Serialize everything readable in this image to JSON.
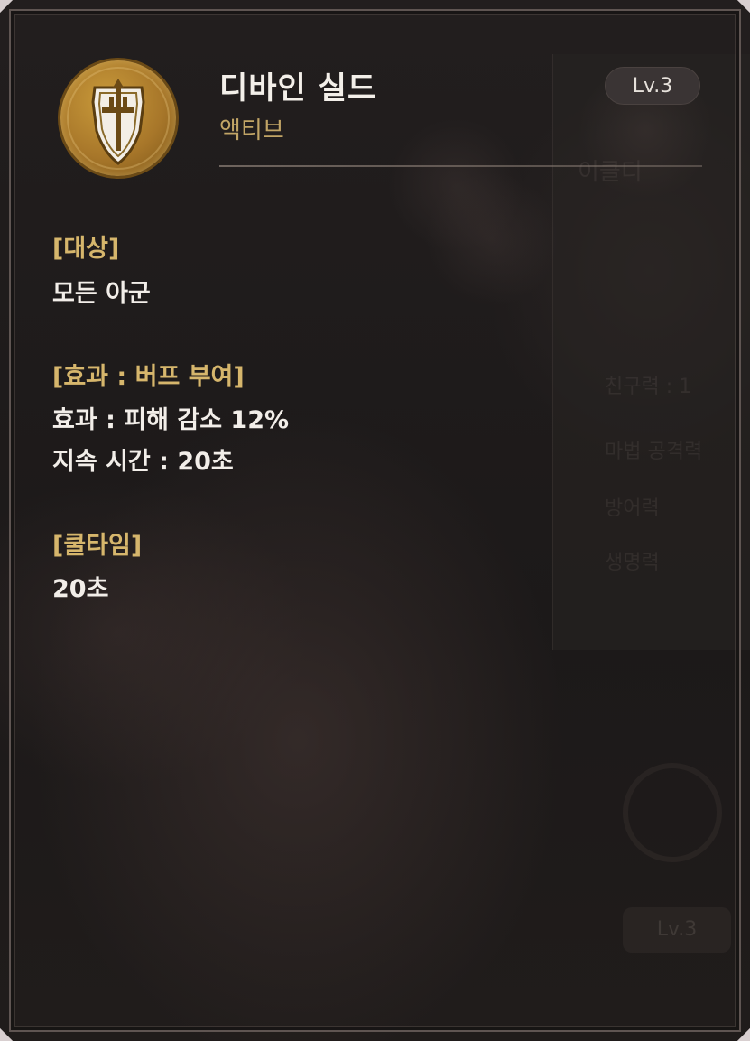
{
  "skill": {
    "name": "디바인 실드",
    "type": "액티브",
    "level": "Lv.3",
    "icon": "shield-sword-icon"
  },
  "sections": {
    "target": {
      "heading": "[대상]",
      "lines": [
        "모든 아군"
      ]
    },
    "effect": {
      "heading": "[효과 : 버프 부여]",
      "lines": [
        "효과 : 피해 감소 12%",
        "지속 시간 : 20초"
      ]
    },
    "cooldown": {
      "heading": "[쿨타임]",
      "lines": [
        "20초"
      ]
    }
  },
  "colors": {
    "panel_bg": "#1d1a1a",
    "heading_gold": "#d6b66c",
    "subtitle_gold": "#c2a566",
    "text_white": "#f2eee9",
    "badge_bg": "#3a3434",
    "icon_gold": "#b0802e"
  }
}
